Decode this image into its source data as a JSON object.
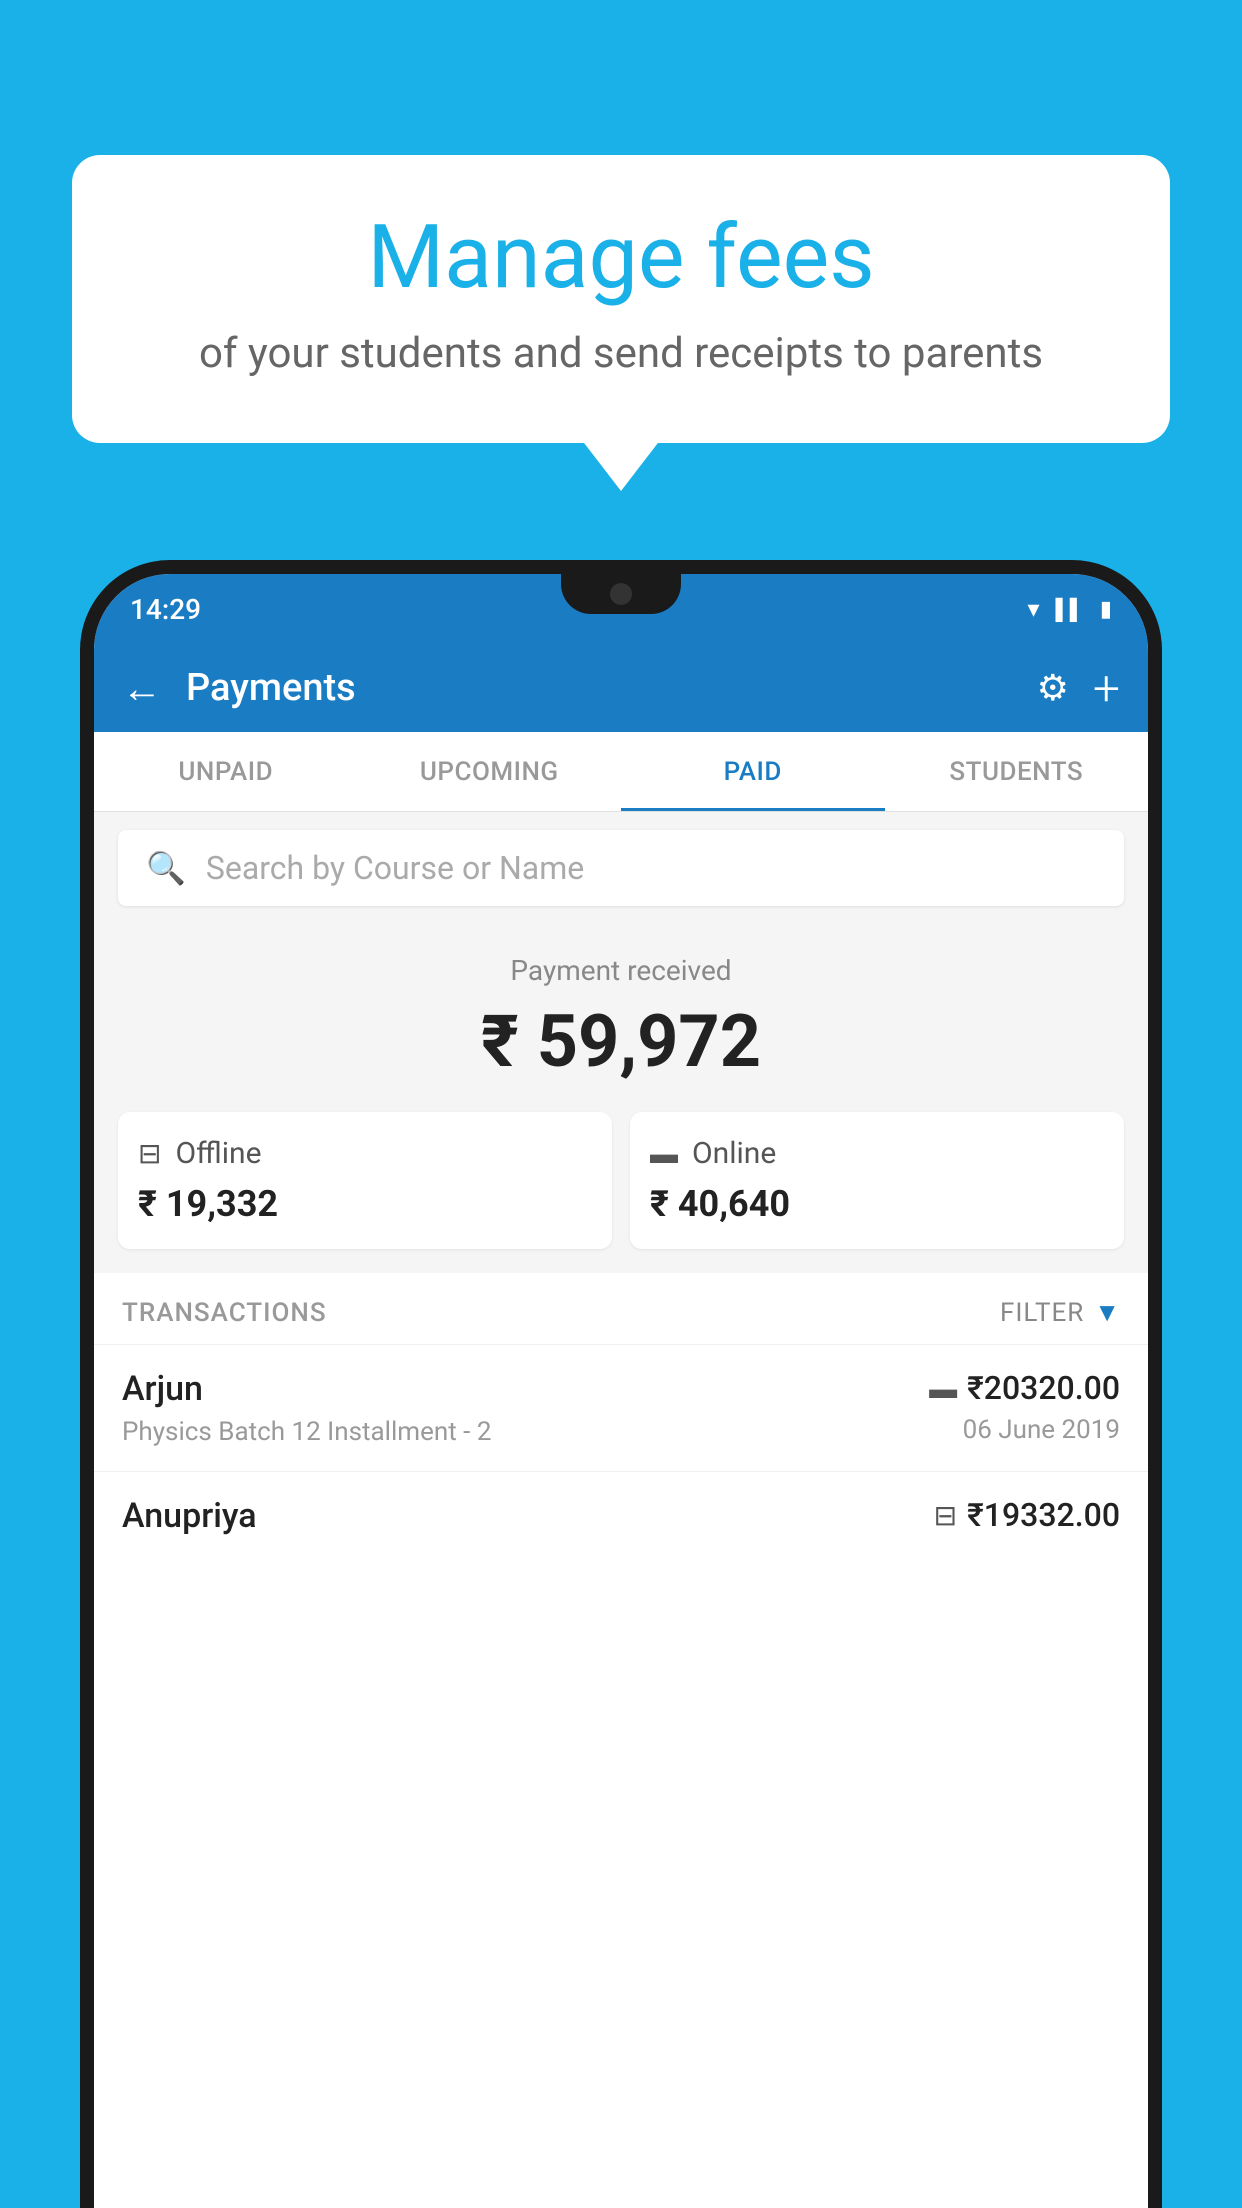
{
  "background_color": "#1ab0e8",
  "speech_bubble": {
    "title": "Manage fees",
    "subtitle": "of your students and send receipts to parents"
  },
  "status_bar": {
    "time": "14:29",
    "wifi_icon": "wifi-icon",
    "signal_icon": "signal-icon",
    "battery_icon": "battery-icon"
  },
  "header": {
    "back_label": "←",
    "title": "Payments",
    "gear_icon": "gear-icon",
    "plus_icon": "plus-icon"
  },
  "tabs": [
    {
      "label": "UNPAID",
      "active": false
    },
    {
      "label": "UPCOMING",
      "active": false
    },
    {
      "label": "PAID",
      "active": true
    },
    {
      "label": "STUDENTS",
      "active": false
    }
  ],
  "search": {
    "placeholder": "Search by Course or Name"
  },
  "payment_summary": {
    "received_label": "Payment received",
    "total_amount": "₹ 59,972",
    "offline": {
      "label": "Offline",
      "amount": "₹ 19,332"
    },
    "online": {
      "label": "Online",
      "amount": "₹ 40,640"
    }
  },
  "transactions": {
    "section_label": "TRANSACTIONS",
    "filter_label": "FILTER",
    "items": [
      {
        "name": "Arjun",
        "description": "Physics Batch 12 Installment - 2",
        "amount": "₹20320.00",
        "date": "06 June 2019",
        "payment_type": "card"
      },
      {
        "name": "Anupriya",
        "description": "",
        "amount": "₹19332.00",
        "date": "",
        "payment_type": "offline"
      }
    ]
  }
}
